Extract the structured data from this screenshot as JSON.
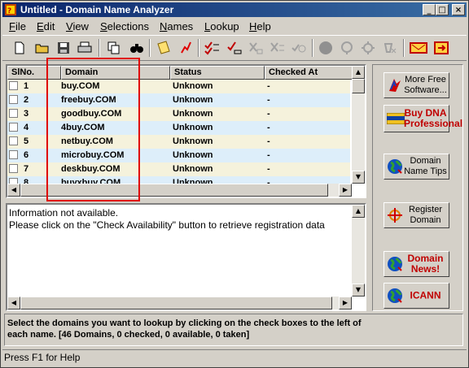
{
  "window": {
    "title": "Untitled - Domain Name Analyzer",
    "min_glyph": "_",
    "max_glyph": "□",
    "close_glyph": "×"
  },
  "menu": [
    {
      "label": "File",
      "ul": "F",
      "rest": "ile"
    },
    {
      "label": "Edit",
      "ul": "E",
      "rest": "dit"
    },
    {
      "label": "View",
      "ul": "V",
      "rest": "iew"
    },
    {
      "label": "Selections",
      "ul": "S",
      "rest": "elections"
    },
    {
      "label": "Names",
      "ul": "N",
      "rest": "ames"
    },
    {
      "label": "Lookup",
      "ul": "L",
      "rest": "ookup"
    },
    {
      "label": "Help",
      "ul": "H",
      "rest": "elp"
    }
  ],
  "table": {
    "headers": {
      "slno": "SlNo.",
      "domain": "Domain",
      "status": "Status",
      "checked_at": "Checked At"
    },
    "rows": [
      {
        "num": "1",
        "domain": "buy.COM",
        "status": "Unknown",
        "checked": "-"
      },
      {
        "num": "2",
        "domain": "freebuy.COM",
        "status": "Unknown",
        "checked": "-"
      },
      {
        "num": "3",
        "domain": "goodbuy.COM",
        "status": "Unknown",
        "checked": "-"
      },
      {
        "num": "4",
        "domain": "4buy.COM",
        "status": "Unknown",
        "checked": "-"
      },
      {
        "num": "5",
        "domain": "netbuy.COM",
        "status": "Unknown",
        "checked": "-"
      },
      {
        "num": "6",
        "domain": "microbuy.COM",
        "status": "Unknown",
        "checked": "-"
      },
      {
        "num": "7",
        "domain": "deskbuy.COM",
        "status": "Unknown",
        "checked": "-"
      },
      {
        "num": "8",
        "domain": "buyxbuy.COM",
        "status": "Unknown",
        "checked": "-"
      }
    ],
    "row_colors": [
      "#f5f2dc",
      "#ddeefa"
    ]
  },
  "info": {
    "line1": "Information not available.",
    "line2": "Please click on the \"Check Availability\" button to retrieve registration data"
  },
  "side_buttons": {
    "more_free": "More Free Software...",
    "buy_dna": "Buy DNA Professional",
    "tips": "Domain Name Tips",
    "register": "Register Domain",
    "news": "Domain News!",
    "icann": "ICANN"
  },
  "hint": "Select the domains you want to lookup by clicking on the check boxes to the left of each name. [46 Domains, 0 checked, 0 available, 0 taken]",
  "status_bar": "Press F1 for Help",
  "colors": {
    "title_bar": "#0a246a",
    "highlight_box": "#e00000",
    "red_label": "#c00000"
  }
}
